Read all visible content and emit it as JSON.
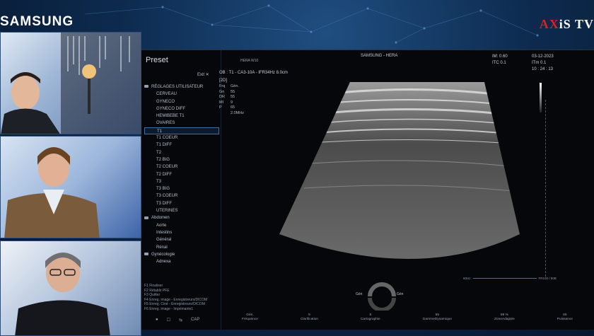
{
  "branding": {
    "left_logo": "SAMSUNG",
    "right_logo_ax": "AX",
    "right_logo_rest": "iS TV"
  },
  "screen": {
    "preset_title": "Preset",
    "exit_label": "Exit ✕",
    "header_center": "SAMSUNG - HERA",
    "probe_model": "HERA W10",
    "scan_params": "OB : T1 - CA3-10A - IFR34Hz  8.0cm",
    "mode_label": "[2D]",
    "params": [
      {
        "k": "Frq",
        "v": "Gén."
      },
      {
        "k": "Gn",
        "v": "55"
      },
      {
        "k": "DR",
        "v": "55"
      },
      {
        "k": "MI",
        "v": "9"
      },
      {
        "k": "P",
        "v": "65"
      },
      {
        "k": "",
        "v": "2.0MHz"
      }
    ],
    "info_right": {
      "im": "IM: 0.60",
      "date": "03-12-2023",
      "itc": "ITC 0.1",
      "itm": "ITm 0.1",
      "time": "10 : 24 : 13"
    },
    "tree": [
      {
        "type": "folder",
        "label": "RÉGLAGES UTILISATEUR"
      },
      {
        "type": "item",
        "label": "CERVEAU"
      },
      {
        "type": "item",
        "label": "GYNECO"
      },
      {
        "type": "item",
        "label": "GYNECO DIFF"
      },
      {
        "type": "item",
        "label": "HEMIBEBE T1"
      },
      {
        "type": "item",
        "label": "OVAIRES"
      },
      {
        "type": "item",
        "label": "T1",
        "selected": true
      },
      {
        "type": "item",
        "label": "T1 COEUR"
      },
      {
        "type": "item",
        "label": "T1 DIFF"
      },
      {
        "type": "item",
        "label": "T2"
      },
      {
        "type": "item",
        "label": "T2 BIG"
      },
      {
        "type": "item",
        "label": "T2 COEUR"
      },
      {
        "type": "item",
        "label": "T2 DIFF"
      },
      {
        "type": "item",
        "label": "T3"
      },
      {
        "type": "item",
        "label": "T3 BIG"
      },
      {
        "type": "item",
        "label": "T3 COEUR"
      },
      {
        "type": "item",
        "label": "T3 DIFF"
      },
      {
        "type": "item",
        "label": "UTERINES"
      },
      {
        "type": "folder",
        "label": "Abdomen"
      },
      {
        "type": "item",
        "label": "Aorte"
      },
      {
        "type": "item",
        "label": "Intestins"
      },
      {
        "type": "item",
        "label": "Général"
      },
      {
        "type": "item",
        "label": "Rénal"
      },
      {
        "type": "folder",
        "label": "Gynécologie"
      },
      {
        "type": "item",
        "label": "Adnexa"
      }
    ],
    "actions": [
      "F1  Finaliser",
      "F2  Rétablir PFE",
      "F3  Quitter",
      "F4  Enreg. image - Enregistreurs/DICOM",
      "F5  Enreg. Ciné - Enregistreurs/DICOM",
      "F6  Enreg. image - Imprimante1"
    ],
    "bottom_icons": [
      "●",
      "☐",
      "⇆",
      "CAP"
    ],
    "gain_left": "60Hz",
    "gain_right": "FR100 / 50B",
    "gauge_left": "Gén",
    "gauge_right": "Gén",
    "bottom_controls": [
      {
        "value": "Gén.",
        "label": "Fréquence"
      },
      {
        "value": "5",
        "label": "Clarification"
      },
      {
        "value": "8",
        "label": "Cartographie"
      },
      {
        "value": "55",
        "label": "GammeDynamique"
      },
      {
        "value": "99 %",
        "label": "ZoneAdaptée"
      },
      {
        "value": "65",
        "label": "Puissance"
      }
    ]
  }
}
